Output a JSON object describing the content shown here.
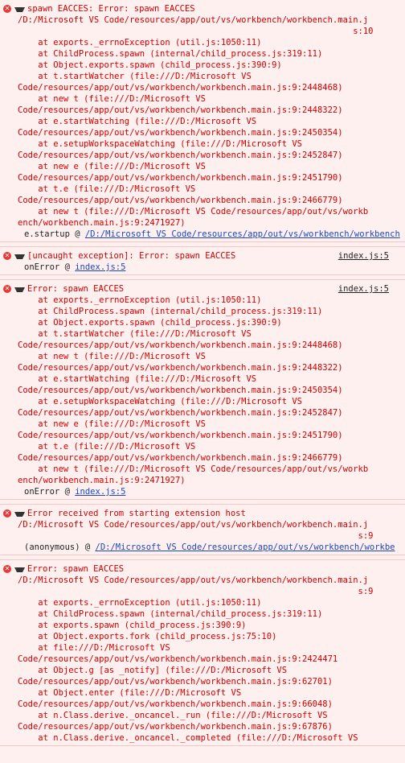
{
  "messages": [
    {
      "head": "spawn EACCES: Error: spawn EACCES",
      "pre": "/D:/Microsoft VS Code/resources/app/out/vs/workbench/workbench.main.j\n                                                                  s:10\n    at exports._errnoException (util.js:1050:11)\n    at ChildProcess.spawn (internal/child_process.js:319:11)\n    at Object.exports.spawn (child_process.js:390:9)\n    at t.startWatcher (file:///D:/Microsoft VS\nCode/resources/app/out/vs/workbench/workbench.main.js:9:2448468)\n    at new t (file:///D:/Microsoft VS\nCode/resources/app/out/vs/workbench/workbench.main.js:9:2448322)\n    at e.startWatching (file:///D:/Microsoft VS\nCode/resources/app/out/vs/workbench/workbench.main.js:9:2450354)\n    at e.setupWorkspaceWatching (file:///D:/Microsoft VS\nCode/resources/app/out/vs/workbench/workbench.main.js:9:2452847)\n    at new e (file:///D:/Microsoft VS\nCode/resources/app/out/vs/workbench/workbench.main.js:9:2451790)\n    at t.e (file:///D:/Microsoft VS\nCode/resources/app/out/vs/workbench/workbench.main.js:9:2466779)\n    at new t (file:///D:/Microsoft VS Code/resources/app/out/vs/workb\nench/workbench.main.js:9:2471927)",
      "caller_name": "e.startup @ ",
      "caller_link": "/D:/Microsoft VS Code/resources/app/out/vs/workbench/workbench"
    },
    {
      "head": "[uncaught exception]: Error: spawn EACCES",
      "source": "index.js:5",
      "caller_name": "onError @ ",
      "caller_link": "index.js:5"
    },
    {
      "head": "Error: spawn EACCES",
      "source": "index.js:5",
      "pre": "    at exports._errnoException (util.js:1050:11)\n    at ChildProcess.spawn (internal/child_process.js:319:11)\n    at Object.exports.spawn (child_process.js:390:9)\n    at t.startWatcher (file:///D:/Microsoft VS\nCode/resources/app/out/vs/workbench/workbench.main.js:9:2448468)\n    at new t (file:///D:/Microsoft VS\nCode/resources/app/out/vs/workbench/workbench.main.js:9:2448322)\n    at e.startWatching (file:///D:/Microsoft VS\nCode/resources/app/out/vs/workbench/workbench.main.js:9:2450354)\n    at e.setupWorkspaceWatching (file:///D:/Microsoft VS\nCode/resources/app/out/vs/workbench/workbench.main.js:9:2452847)\n    at new e (file:///D:/Microsoft VS\nCode/resources/app/out/vs/workbench/workbench.main.js:9:2451790)\n    at t.e (file:///D:/Microsoft VS\nCode/resources/app/out/vs/workbench/workbench.main.js:9:2466779)\n    at new t (file:///D:/Microsoft VS Code/resources/app/out/vs/workb\nench/workbench.main.js:9:2471927)",
      "caller_name": "onError @ ",
      "caller_link": "index.js:5"
    },
    {
      "head": "Error received from starting extension host",
      "pre": "/D:/Microsoft VS Code/resources/app/out/vs/workbench/workbench.main.j\n                                                                   s:9",
      "caller_name": "(anonymous) @ ",
      "caller_link": "/D:/Microsoft VS Code/resources/app/out/vs/workbench/workbe"
    },
    {
      "head": "Error: spawn EACCES",
      "pre": "/D:/Microsoft VS Code/resources/app/out/vs/workbench/workbench.main.j\n                                                                   s:9\n    at exports._errnoException (util.js:1050:11)\n    at ChildProcess.spawn (internal/child_process.js:319:11)\n    at exports.spawn (child_process.js:390:9)\n    at Object.exports.fork (child_process.js:75:10)\n    at file:///D:/Microsoft VS\nCode/resources/app/out/vs/workbench/workbench.main.js:9:2424471\n    at Object.g [as _notify] (file:///D:/Microsoft VS\nCode/resources/app/out/vs/workbench/workbench.main.js:9:62701)\n    at Object.enter (file:///D:/Microsoft VS\nCode/resources/app/out/vs/workbench/workbench.main.js:9:66048)\n    at n.Class.derive._oncancel._run (file:///D:/Microsoft VS\nCode/resources/app/out/vs/workbench/workbench.main.js:9:67876)\n    at n.Class.derive._oncancel._completed (file:///D:/Microsoft VS"
    }
  ]
}
